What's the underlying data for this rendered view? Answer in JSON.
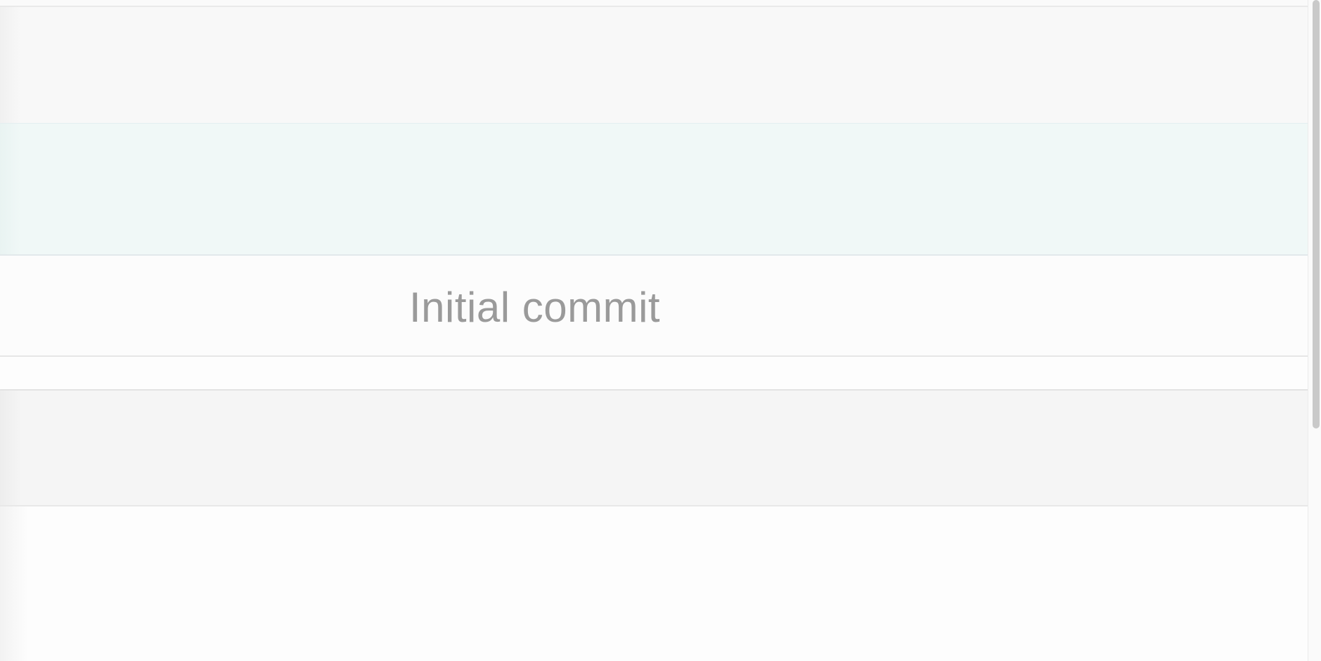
{
  "commit_list": {
    "rows": [
      {
        "message": ""
      },
      {
        "message": ""
      },
      {
        "message": "Initial commit"
      },
      {
        "message": ""
      },
      {
        "message": ""
      },
      {
        "message": ""
      }
    ],
    "selected_row_index": 1
  },
  "colors": {
    "selected_row_bg": "#f0f8f7",
    "commit_text": "#9a9a9a",
    "scroll_thumb": "#c9c9c9"
  }
}
